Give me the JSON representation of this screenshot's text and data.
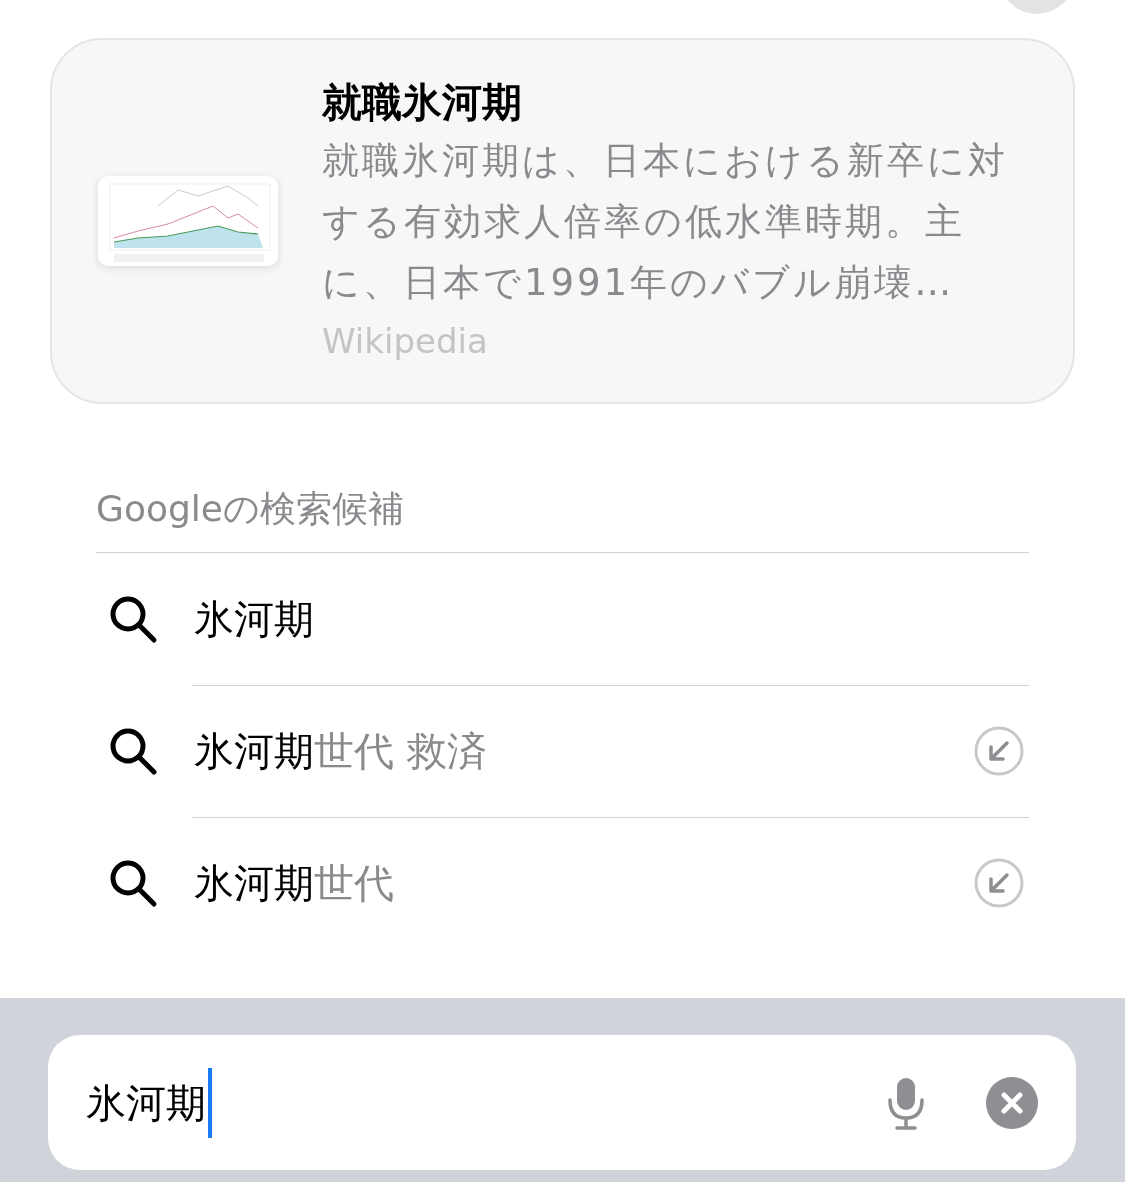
{
  "knowledge_card": {
    "title": "就職氷河期",
    "description": "就職氷河期は、日本における新卒に対する有効求人倍率の低水準時期。主に、日本で1991年のバブル崩壊…",
    "source": "Wikipedia"
  },
  "suggestions": {
    "header": "Googleの検索候補",
    "items": [
      {
        "typed": "氷河期",
        "fill_arrow": false
      },
      {
        "typed": "氷河期",
        "completion": "世代 救済",
        "fill_arrow": true
      },
      {
        "typed": "氷河期",
        "completion": "世代",
        "fill_arrow": true
      }
    ]
  },
  "search_bar": {
    "value": "氷河期"
  }
}
